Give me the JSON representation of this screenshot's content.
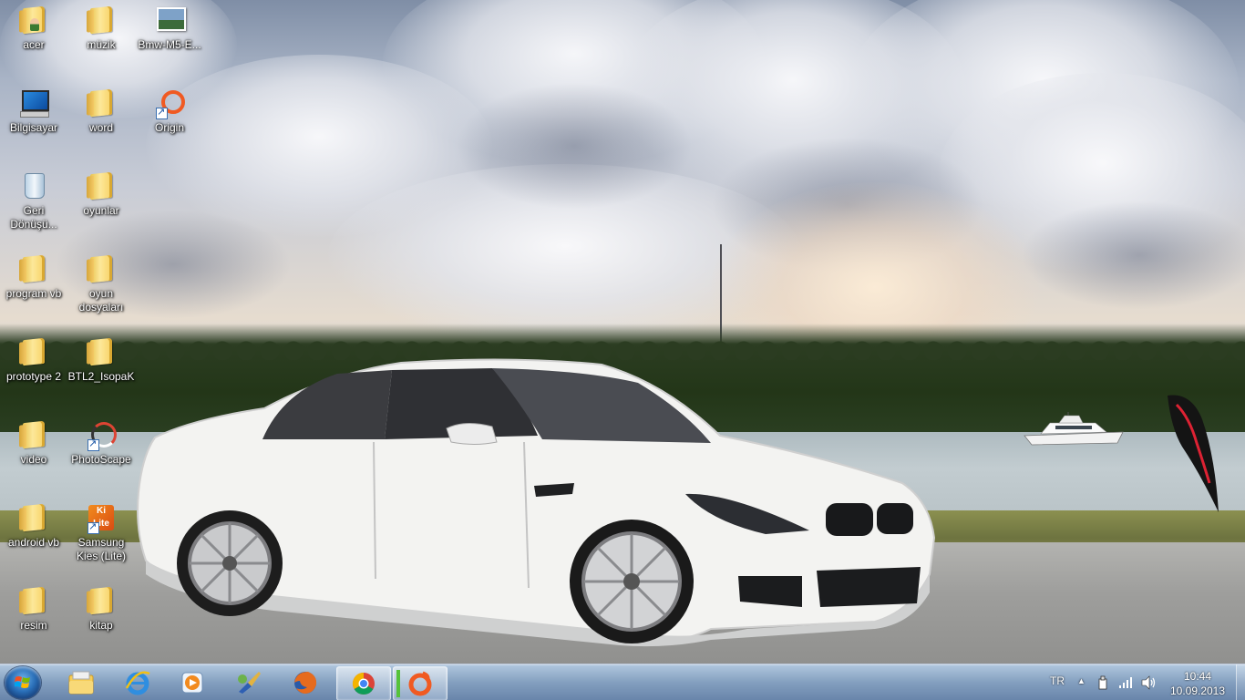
{
  "desktop": {
    "icons": [
      {
        "label": "acer",
        "type": "user-folder",
        "icon": "user-folder-icon"
      },
      {
        "label": "müzik",
        "type": "folder",
        "icon": "folder-icon"
      },
      {
        "label": "Bmw-M5-E...",
        "type": "image",
        "icon": "image-file-icon"
      },
      {
        "label": "Bilgisayar",
        "type": "computer",
        "icon": "computer-icon"
      },
      {
        "label": "word",
        "type": "folder",
        "icon": "folder-icon"
      },
      {
        "label": "Origin",
        "type": "shortcut",
        "icon": "origin-icon"
      },
      {
        "label": "Geri Dönüşü...",
        "type": "recycle-bin",
        "icon": "recycle-bin-icon"
      },
      {
        "label": "oyunlar",
        "type": "folder",
        "icon": "folder-icon"
      },
      {
        "label": "program vb",
        "type": "folder",
        "icon": "folder-icon"
      },
      {
        "label": "oyun dosyaları",
        "type": "folder",
        "icon": "folder-icon"
      },
      {
        "label": "prototype 2",
        "type": "folder",
        "icon": "folder-icon"
      },
      {
        "label": "BTL2_IsopaK",
        "type": "folder",
        "icon": "folder-icon"
      },
      {
        "label": "video",
        "type": "folder",
        "icon": "folder-icon"
      },
      {
        "label": "PhotoScape",
        "type": "shortcut",
        "icon": "photoscape-icon"
      },
      {
        "label": "android vb",
        "type": "folder",
        "icon": "folder-icon"
      },
      {
        "label": "Samsung Kies (Lite)",
        "type": "shortcut",
        "icon": "kies-icon"
      },
      {
        "label": "resim",
        "type": "folder",
        "icon": "folder-icon"
      },
      {
        "label": "kitap",
        "type": "folder",
        "icon": "folder-icon"
      }
    ]
  },
  "taskbar": {
    "start_icon": "windows-start-icon",
    "pinned": [
      {
        "name": "explorer",
        "icon": "file-explorer-icon",
        "active": false
      },
      {
        "name": "internet-explorer",
        "icon": "internet-explorer-icon",
        "active": false
      },
      {
        "name": "media-player",
        "icon": "media-player-icon",
        "active": false
      },
      {
        "name": "paint-tool",
        "icon": "paint-brush-icon",
        "active": false
      },
      {
        "name": "firefox",
        "icon": "firefox-icon",
        "active": false
      },
      {
        "name": "chrome",
        "icon": "chrome-icon",
        "active": true
      },
      {
        "name": "origin",
        "icon": "origin-icon",
        "active": true
      }
    ],
    "tray": {
      "language": "TR",
      "icons": [
        "show-hidden-icons-icon",
        "usb-device-icon",
        "signal-icon",
        "volume-icon"
      ],
      "time": "10:44",
      "date": "10.09.2013"
    }
  },
  "colors": {
    "taskbar": "#7d9cc0",
    "folder": "#f7d163",
    "origin_orange": "#f05a22"
  }
}
